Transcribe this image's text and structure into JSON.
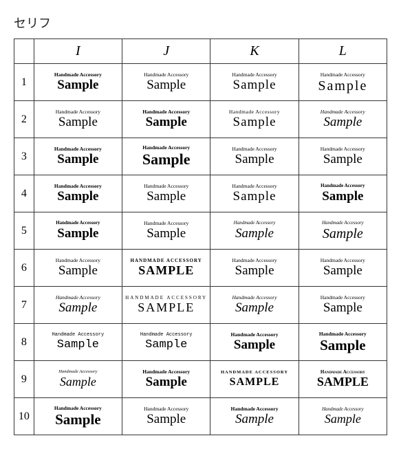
{
  "title": "セリフ",
  "columns": [
    "",
    "I",
    "J",
    "K",
    "L"
  ],
  "rows": [
    {
      "num": "1",
      "cells": [
        {
          "top": "Handmade Accessory",
          "main": "Sample",
          "topClass": "s-i1-top",
          "mainClass": "s-i1-main"
        },
        {
          "top": "Handmade Accessory",
          "main": "Sample",
          "topClass": "s-j1-top",
          "mainClass": "s-j1-main"
        },
        {
          "top": "Handmade Accessory",
          "main": "Sample",
          "topClass": "s-k1-top",
          "mainClass": "s-k1-main"
        },
        {
          "top": "Handmade Accessory",
          "main": "Sample",
          "topClass": "s-l1-top",
          "mainClass": "s-l1-main"
        }
      ]
    },
    {
      "num": "2",
      "cells": [
        {
          "top": "Handmade Accessory",
          "main": "Sample",
          "topClass": "s-i2-top",
          "mainClass": "s-i2-main"
        },
        {
          "top": "Handmade Accessory",
          "main": "Sample",
          "topClass": "s-j2-top",
          "mainClass": "s-j2-main"
        },
        {
          "top": "Handmade Accessory",
          "main": "Sample",
          "topClass": "s-k2-top",
          "mainClass": "s-k2-main"
        },
        {
          "top": "Handmade Accessory",
          "main": "Sample",
          "topClass": "s-l2-top",
          "mainClass": "s-l2-main"
        }
      ]
    },
    {
      "num": "3",
      "cells": [
        {
          "top": "Handmade Accessory",
          "main": "Sample",
          "topClass": "s-i3-top",
          "mainClass": "s-i3-main"
        },
        {
          "top": "Handmade Accessory",
          "main": "Sample",
          "topClass": "s-j3-top",
          "mainClass": "s-j3-main"
        },
        {
          "top": "Handmade Accessory",
          "main": "Sample",
          "topClass": "s-k3-top",
          "mainClass": "s-k3-main"
        },
        {
          "top": "Handmade Accessory",
          "main": "Sample",
          "topClass": "s-l3-top",
          "mainClass": "s-l3-main"
        }
      ]
    },
    {
      "num": "4",
      "cells": [
        {
          "top": "Handmade Accessory",
          "main": "Sample",
          "topClass": "s-i4-top",
          "mainClass": "s-i4-main"
        },
        {
          "top": "Handmade Accessory",
          "main": "Sample",
          "topClass": "s-j4-top",
          "mainClass": "s-j4-main"
        },
        {
          "top": "Handmade Accessory",
          "main": "Sample",
          "topClass": "s-k4-top",
          "mainClass": "s-k4-main"
        },
        {
          "top": "Handmade Accessory",
          "main": "Sample",
          "topClass": "s-l4-top",
          "mainClass": "s-l4-main"
        }
      ]
    },
    {
      "num": "5",
      "cells": [
        {
          "top": "Handmade Accessory",
          "main": "Sample",
          "topClass": "s-i5-top",
          "mainClass": "s-i5-main"
        },
        {
          "top": "Handmade Accessory",
          "main": "Sample",
          "topClass": "s-j5-top",
          "mainClass": "s-j5-main"
        },
        {
          "top": "Handmade Accessory",
          "main": "Sample",
          "topClass": "s-k5-top",
          "mainClass": "s-k5-main"
        },
        {
          "top": "Handmade Accessory",
          "main": "Sample",
          "topClass": "s-l5-top",
          "mainClass": "s-l5-main"
        }
      ]
    },
    {
      "num": "6",
      "cells": [
        {
          "top": "Handmade Accessory",
          "main": "Sample",
          "topClass": "s-i6-top",
          "mainClass": "s-i6-main"
        },
        {
          "top": "HANDMADE ACCESSORY",
          "main": "SAMPLE",
          "topClass": "s-j6-top",
          "mainClass": "s-j6-main"
        },
        {
          "top": "Handmade Accessory",
          "main": "Sample",
          "topClass": "s-k6-top",
          "mainClass": "s-k6-main"
        },
        {
          "top": "Handmade Accessory",
          "main": "Sample",
          "topClass": "s-l6-top",
          "mainClass": "s-l6-main"
        }
      ]
    },
    {
      "num": "7",
      "cells": [
        {
          "top": "Handmade Accessory",
          "main": "Sample",
          "topClass": "s-i7-top",
          "mainClass": "s-i7-main"
        },
        {
          "top": "HANDMADE ACCESSORY",
          "main": "SAMPLE",
          "topClass": "s-j7-top",
          "mainClass": "s-j7-main"
        },
        {
          "top": "Handmade Accessory",
          "main": "Sample",
          "topClass": "s-k7-top",
          "mainClass": "s-k7-main"
        },
        {
          "top": "Handmade Accessory",
          "main": "Sample",
          "topClass": "s-l7-top",
          "mainClass": "s-l7-main"
        }
      ]
    },
    {
      "num": "8",
      "cells": [
        {
          "top": "Handmade Accessory",
          "main": "Sample",
          "topClass": "s-i8-top",
          "mainClass": "s-i8-main"
        },
        {
          "top": "Handmade Accessory",
          "main": "Sample",
          "topClass": "s-j8-top",
          "mainClass": "s-j8-main"
        },
        {
          "top": "Handmade Accessory",
          "main": "Sample",
          "topClass": "s-k8-top",
          "mainClass": "s-k8-main"
        },
        {
          "top": "Handmade Accessory",
          "main": "Sample",
          "topClass": "s-l8-top",
          "mainClass": "s-l8-main"
        }
      ]
    },
    {
      "num": "9",
      "cells": [
        {
          "top": "Handmade Accessory",
          "main": "Sample",
          "topClass": "s-i9-top",
          "mainClass": "s-i9-main"
        },
        {
          "top": "Handmade Accessory",
          "main": "Sample",
          "topClass": "s-j9-top",
          "mainClass": "s-j9-main"
        },
        {
          "top": "HANDMADE ACCESSORY",
          "main": "SAMPLE",
          "topClass": "s-k9-top",
          "mainClass": "s-k9-main"
        },
        {
          "top": "Handmade Accessory",
          "main": "SAMPLE",
          "topClass": "s-l9-top",
          "mainClass": "s-l9-main"
        }
      ]
    },
    {
      "num": "10",
      "cells": [
        {
          "top": "Handmade Accessory",
          "main": "Sample",
          "topClass": "s-i10-top",
          "mainClass": "s-i10-main"
        },
        {
          "top": "Handmade Accessory",
          "main": "Sample",
          "topClass": "s-j10-top",
          "mainClass": "s-j10-main"
        },
        {
          "top": "Handmade Accessory",
          "main": "Sample",
          "topClass": "s-k10-top",
          "mainClass": "s-k10-main"
        },
        {
          "top": "Handmade Accessory",
          "main": "Sample",
          "topClass": "s-l10-top",
          "mainClass": "s-l10-main"
        }
      ]
    }
  ]
}
